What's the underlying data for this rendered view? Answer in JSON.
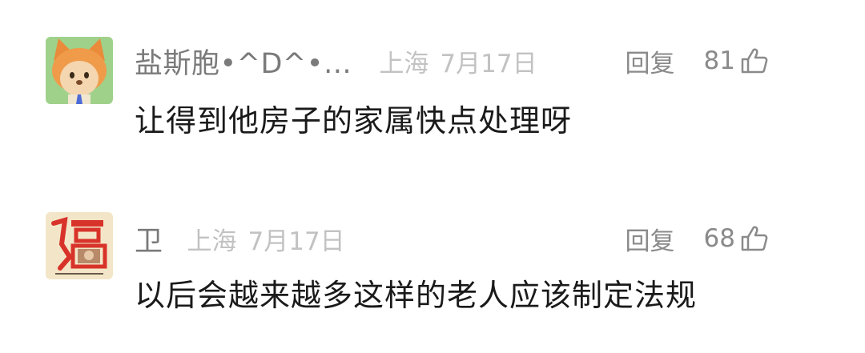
{
  "comments": [
    {
      "username": "盐斯胞•^D^•…",
      "location": "上海",
      "date": "7月17日",
      "reply_label": "回复",
      "like_count": "81",
      "text": "让得到他房子的家属快点处理呀",
      "avatar_icon": "cartoon-fox-avatar-icon",
      "like_icon": "thumbs-up-icon"
    },
    {
      "username": "卫",
      "location": "上海",
      "date": "7月17日",
      "reply_label": "回复",
      "like_count": "68",
      "text": "以后会越来越多这样的老人应该制定法规",
      "avatar_icon": "fu-character-avatar-icon",
      "like_icon": "thumbs-up-icon"
    }
  ],
  "colors": {
    "username": "#7a7a7a",
    "meta": "#c2c2c2",
    "action": "#8a8a8a",
    "text": "#1a1a1a"
  }
}
